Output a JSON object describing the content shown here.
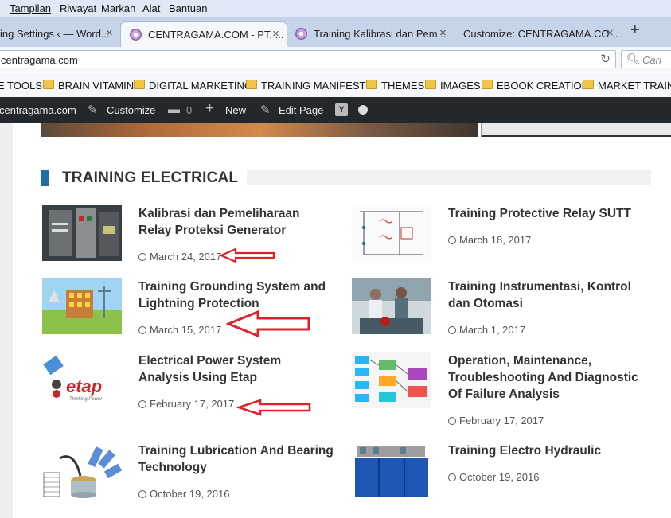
{
  "menubar": {
    "items": [
      "Tampilan",
      "Riwayat",
      "Markah",
      "Alat",
      "Bantuan"
    ]
  },
  "tabs": [
    {
      "label": "ing Settings ‹ — Word...",
      "active": false
    },
    {
      "label": "CENTRAGAMA.COM - PT. ...",
      "active": true
    },
    {
      "label": "Training Kalibrasi dan Pem...",
      "active": false
    },
    {
      "label": "Customize: CENTRAGAMA.CO...",
      "active": false
    }
  ],
  "tab_close": "×",
  "new_tab": "+",
  "address": {
    "url": "centragama.com",
    "search_placeholder": "Cari",
    "reload_icon": "reload-icon"
  },
  "bookmarks": [
    {
      "label": "E TOOLS",
      "folder": false
    },
    {
      "label": "BRAIN VITAMIN",
      "folder": true
    },
    {
      "label": "DIGITAL MARKETING",
      "folder": true
    },
    {
      "label": "TRAINING MANIFESTO",
      "folder": true
    },
    {
      "label": "THEMES",
      "folder": true
    },
    {
      "label": "IMAGES",
      "folder": true
    },
    {
      "label": "EBOOK CREATION",
      "folder": true
    },
    {
      "label": "MARKET TRAINING",
      "folder": true
    }
  ],
  "adminbar": {
    "site": "centragama.com",
    "customize": "Customize",
    "comments": "0",
    "new": "New",
    "edit_page": "Edit Page",
    "yoast": "Y"
  },
  "section": {
    "title": "TRAINING ELECTRICAL",
    "accent": "#1f6fad"
  },
  "posts": [
    {
      "title": "Kalibrasi dan Pemeliharaan Relay Proteksi Generator",
      "date": "March 24, 2017"
    },
    {
      "title": "Training Protective Relay SUTT",
      "date": "March 18, 2017"
    },
    {
      "title": "Training Grounding System and Lightning Protection",
      "date": "March 15, 2017"
    },
    {
      "title": "Training Instrumentasi, Kontrol dan Otomasi",
      "date": "March 1, 2017"
    },
    {
      "title": "Electrical Power System Analysis Using Etap",
      "date": "February 17, 2017"
    },
    {
      "title": "Operation, Maintenance, Troubleshooting And Diagnostic Of Failure Analysis",
      "date": "February 17, 2017"
    },
    {
      "title": "Training Lubrication And Bearing Technology",
      "date": "October 19, 2016"
    },
    {
      "title": "Training Electro Hydraulic",
      "date": "October 19, 2016"
    }
  ],
  "etap_logo": {
    "text": "etap",
    "tagline": "Thinking Power"
  },
  "annotation_color": "#e0202a"
}
